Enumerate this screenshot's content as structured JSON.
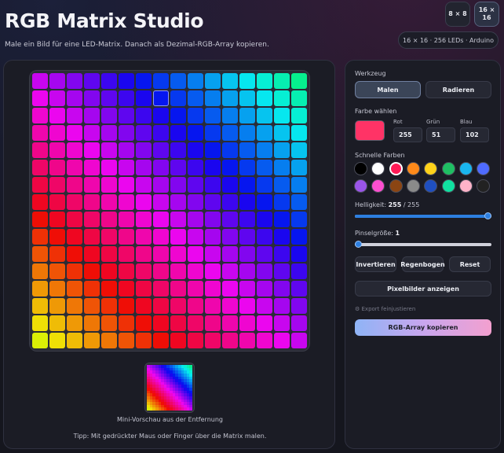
{
  "header": {
    "title": "RGB Matrix Studio",
    "subtitle": "Male ein Bild für eine LED-Matrix. Danach als Dezimal-RGB-Array kopieren.",
    "size_8": "8 × 8",
    "size_16": "16 ×\n16",
    "info": "16 × 16 · 256 LEDs · Arduino"
  },
  "canvas": {
    "grid_size": 16,
    "mini_label": "Mini-Vorschau aus der Entfernung",
    "tip": "Tipp: Mit gedrückter Maus oder Finger über die Matrix malen."
  },
  "tools": {
    "label": "Werkzeug",
    "paint": "Malen",
    "erase": "Radieren"
  },
  "color": {
    "label": "Farbe wählen",
    "current_hex": "#ff3366",
    "red_label": "Rot",
    "red_value": "255",
    "green_label": "Grün",
    "green_value": "51",
    "blue_label": "Blau",
    "blue_value": "102"
  },
  "quick_colors": {
    "label": "Schnelle Farben",
    "colors": [
      "#000000",
      "#ffffff",
      "#ff1a55",
      "#ff8a1a",
      "#ffd21a",
      "#1fbf63",
      "#19b6ef",
      "#4f6bff",
      "#9a55e8",
      "#ff4fd0",
      "#8b4513",
      "#8a8a8a",
      "#1f4fc0",
      "#10e0a0",
      "#ffb3c8",
      "#222222"
    ],
    "selected_index": 2
  },
  "brightness": {
    "label": "Helligkeit:",
    "value": "255",
    "max_text": "/ 255",
    "fraction": 1.0
  },
  "brush": {
    "label": "Pinselgröße:",
    "value": "1",
    "fraction": 0.0
  },
  "actions": {
    "invert": "Invertieren",
    "rainbow": "Regenbogen",
    "reset": "Reset",
    "show_pixels": "Pixelbilder anzeigen",
    "fine_tune": "⚙ Export feinjustieren",
    "copy": "RGB-Array kopieren"
  }
}
